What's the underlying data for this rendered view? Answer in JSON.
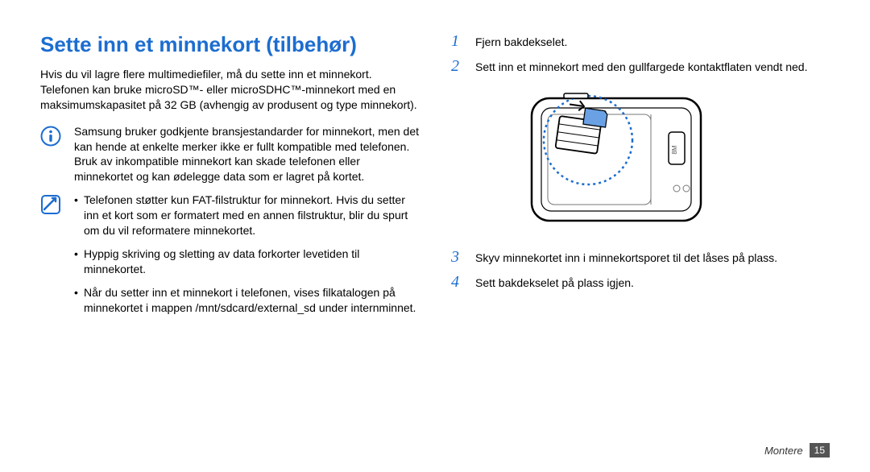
{
  "heading": "Sette inn et minnekort (tilbehør)",
  "intro": "Hvis du vil lagre flere multimediefiler, må du sette inn et minnekort. Telefonen kan bruke microSD™- eller microSDHC™-minnekort med en maksimumskapasitet på 32 GB (avhengig av produsent og type minnekort).",
  "warning": "Samsung bruker godkjente bransjestandarder for minnekort, men det kan hende at enkelte merker ikke er fullt kompatible med telefonen. Bruk av inkompatible minnekort kan skade telefonen eller minnekortet og kan ødelegge data som er lagret på kortet.",
  "notes": [
    "Telefonen støtter kun FAT-filstruktur for minnekort. Hvis du setter inn et kort som er formatert med en annen filstruktur, blir du spurt om du vil reformatere minnekortet.",
    "Hyppig skriving og sletting av data forkorter levetiden til minnekortet.",
    "Når du setter inn et minnekort i telefonen, vises filkatalogen på minnekortet i mappen /mnt/sdcard/external_sd under internminnet."
  ],
  "steps": [
    {
      "num": "1",
      "text": "Fjern bakdekselet."
    },
    {
      "num": "2",
      "text": "Sett inn et minnekort med den gullfargede kontaktflaten vendt ned."
    },
    {
      "num": "3",
      "text": "Skyv minnekortet inn i minnekortsporet til det låses på plass."
    },
    {
      "num": "4",
      "text": "Sett bakdekselet på plass igjen."
    }
  ],
  "footer": {
    "section": "Montere",
    "page": "15"
  }
}
